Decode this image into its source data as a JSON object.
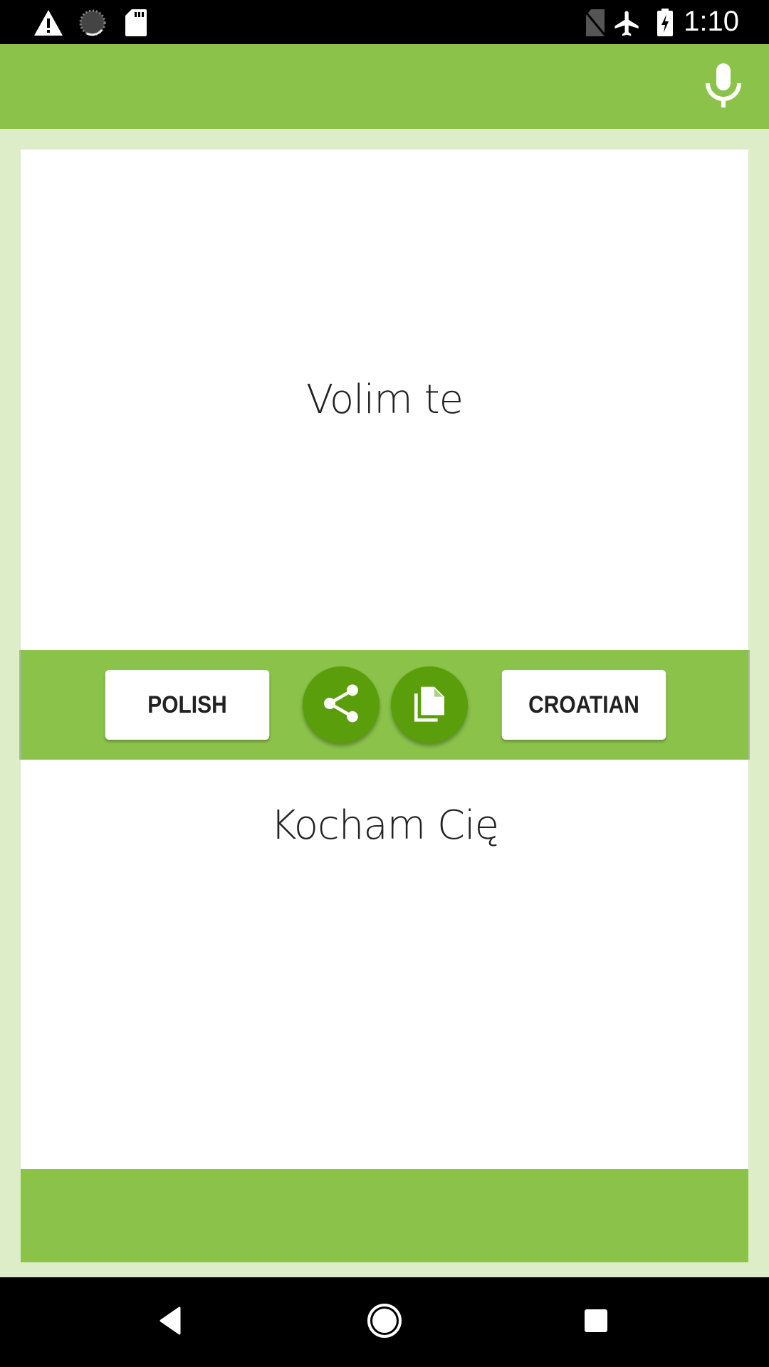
{
  "status_bar": {
    "time": "1:10",
    "left_icons": [
      "warning-icon",
      "sync-progress-icon",
      "sd-card-icon"
    ],
    "right_icons": [
      "no-sim-icon",
      "airplane-mode-icon",
      "battery-charging-icon"
    ]
  },
  "toolbar": {
    "mic_icon": "microphone-icon"
  },
  "translator": {
    "source_text": "Volim te",
    "target_text": "Kocham Cię",
    "source_language": "POLISH",
    "target_language": "CROATIAN",
    "share_icon": "share-icon",
    "copy_icon": "copy-icon"
  },
  "colors": {
    "primary": "#8bc34a",
    "primary_dark": "#5a9e0b",
    "background": "#dcedc8"
  },
  "nav_bar": {
    "buttons": [
      "back",
      "home",
      "recents"
    ]
  }
}
